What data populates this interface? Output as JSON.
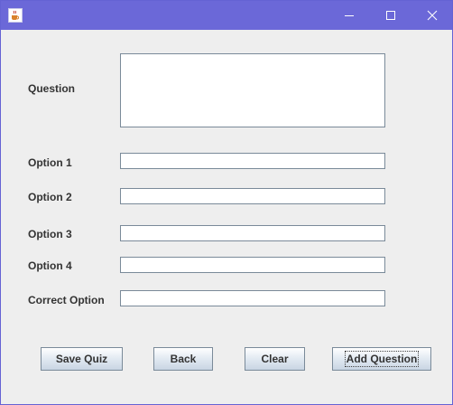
{
  "window": {
    "title": "",
    "icon": "java-cup-icon",
    "controls": [
      "minimize-icon",
      "maximize-icon",
      "close-icon"
    ]
  },
  "form": {
    "question_label": "Question",
    "question_value": "",
    "option1_label": "Option 1",
    "option1_value": "",
    "option2_label": "Option 2",
    "option2_value": "",
    "option3_label": "Option 3",
    "option3_value": "",
    "option4_label": "Option 4",
    "option4_value": "",
    "correct_label": "Correct Option",
    "correct_value": ""
  },
  "buttons": {
    "save": "Save Quiz",
    "back": "Back",
    "clear": "Clear",
    "add": "Add Question"
  },
  "colors": {
    "titlebar": "#6b68d8",
    "background": "#eeeeee"
  }
}
